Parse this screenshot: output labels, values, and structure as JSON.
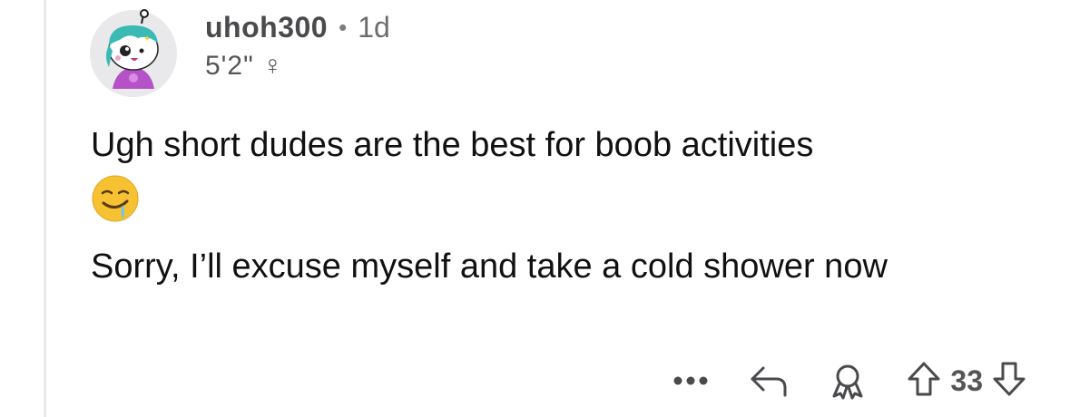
{
  "comment": {
    "username": "uhoh300",
    "separator": "•",
    "age": "1d",
    "flair": "5'2\" ♀",
    "paragraph1": "Ugh short dudes are the best for boob activities",
    "paragraph2": "Sorry, I’ll excuse myself and take a cold shower now",
    "emoji": "drooling-face-emoji"
  },
  "actions": {
    "more_icon": "more-dots-icon",
    "reply_icon": "reply-arrow-icon",
    "award_icon": "award-icon",
    "upvote_icon": "upvote-arrow-icon",
    "vote_count": "33",
    "downvote_icon": "downvote-arrow-icon"
  },
  "colors": {
    "avatar_bg": "#e9e9ec",
    "avatar_hair": "#3bb9b4",
    "avatar_shirt": "#b552c7",
    "emoji_face": "#f6c233",
    "thread_line": "#e9e9eb",
    "icon_gray": "#787c7e"
  }
}
